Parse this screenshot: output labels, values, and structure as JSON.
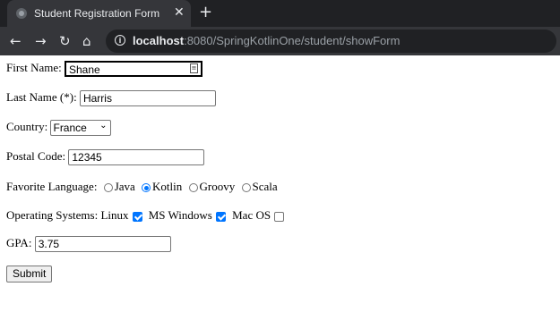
{
  "browser": {
    "tab_title": "Student Registration Form",
    "tab_close": "✕",
    "new_tab": "+",
    "nav": {
      "back": "←",
      "forward": "→",
      "reload": "↻",
      "home": "⌂"
    },
    "url_host": "localhost",
    "url_rest": ":8080/SpringKotlinOne/student/showForm"
  },
  "form": {
    "first_name": {
      "label": "First Name:",
      "value": "Shane"
    },
    "last_name": {
      "label": "Last Name (*):",
      "value": "Harris"
    },
    "country": {
      "label": "Country:",
      "value": "France"
    },
    "postal_code": {
      "label": "Postal Code:",
      "value": "12345"
    },
    "favorite_language": {
      "label": "Favorite Language:",
      "options": [
        {
          "label": "Java",
          "checked": false
        },
        {
          "label": "Kotlin",
          "checked": true
        },
        {
          "label": "Groovy",
          "checked": false
        },
        {
          "label": "Scala",
          "checked": false
        }
      ]
    },
    "operating_systems": {
      "label": "Operating Systems:",
      "options": [
        {
          "label": "Linux",
          "checked": true
        },
        {
          "label": "MS Windows",
          "checked": true
        },
        {
          "label": "Mac OS",
          "checked": false
        }
      ]
    },
    "gpa": {
      "label": "GPA:",
      "value": "3.75"
    },
    "submit_label": "Submit"
  },
  "colors": {
    "accent": "#0075ff",
    "chrome_dark": "#202124",
    "chrome_tab": "#35363a"
  }
}
